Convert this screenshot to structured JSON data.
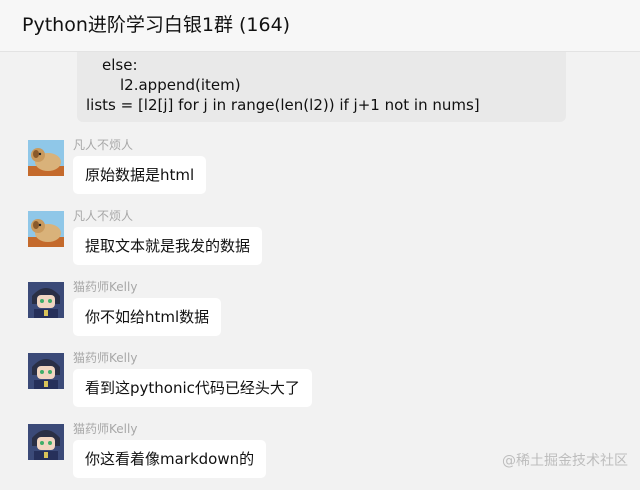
{
  "window": {
    "title": "Python进阶学习白银1群 (164)"
  },
  "code_message": {
    "lines": [
      "else:",
      "l2.append(item)",
      "lists = [l2[j] for j in range(len(l2)) if j+1 not in nums]"
    ]
  },
  "messages": [
    {
      "sender": "凡人不烦人",
      "text": "原始数据是html",
      "avatar": "dog-avatar"
    },
    {
      "sender": "凡人不烦人",
      "text": "提取文本就是我发的数据",
      "avatar": "dog-avatar"
    },
    {
      "sender": "猫药师Kelly",
      "text": "你不如给html数据",
      "avatar": "anime-character-avatar"
    },
    {
      "sender": "猫药师Kelly",
      "text": "看到这pythonic代码已经头大了",
      "avatar": "anime-character-avatar"
    },
    {
      "sender": "猫药师Kelly",
      "text": "你这看着像markdown的",
      "avatar": "anime-character-avatar"
    }
  ],
  "watermark": "@稀土掘金技术社区",
  "colors": {
    "background": "#f2f2f2",
    "bubble": "#ffffff",
    "code_bubble": "#e9e9e9",
    "sender_name": "#a7a7a7"
  }
}
